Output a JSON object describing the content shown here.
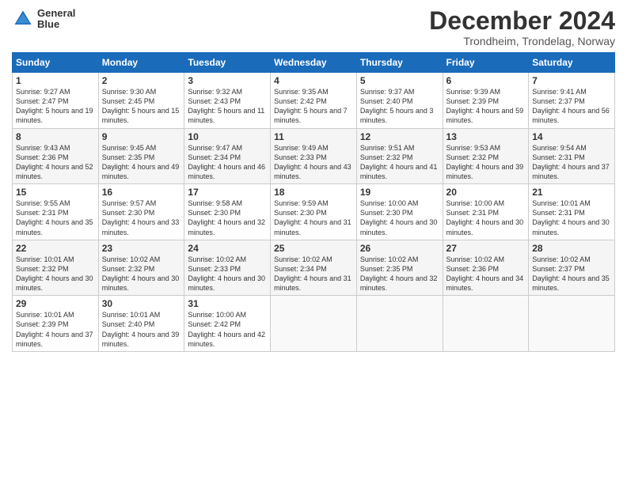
{
  "app": {
    "logo_line1": "General",
    "logo_line2": "Blue"
  },
  "header": {
    "title": "December 2024",
    "subtitle": "Trondheim, Trondelag, Norway"
  },
  "calendar": {
    "days_of_week": [
      "Sunday",
      "Monday",
      "Tuesday",
      "Wednesday",
      "Thursday",
      "Friday",
      "Saturday"
    ],
    "weeks": [
      [
        {
          "day": "1",
          "sunrise": "Sunrise: 9:27 AM",
          "sunset": "Sunset: 2:47 PM",
          "daylight": "Daylight: 5 hours and 19 minutes."
        },
        {
          "day": "2",
          "sunrise": "Sunrise: 9:30 AM",
          "sunset": "Sunset: 2:45 PM",
          "daylight": "Daylight: 5 hours and 15 minutes."
        },
        {
          "day": "3",
          "sunrise": "Sunrise: 9:32 AM",
          "sunset": "Sunset: 2:43 PM",
          "daylight": "Daylight: 5 hours and 11 minutes."
        },
        {
          "day": "4",
          "sunrise": "Sunrise: 9:35 AM",
          "sunset": "Sunset: 2:42 PM",
          "daylight": "Daylight: 5 hours and 7 minutes."
        },
        {
          "day": "5",
          "sunrise": "Sunrise: 9:37 AM",
          "sunset": "Sunset: 2:40 PM",
          "daylight": "Daylight: 5 hours and 3 minutes."
        },
        {
          "day": "6",
          "sunrise": "Sunrise: 9:39 AM",
          "sunset": "Sunset: 2:39 PM",
          "daylight": "Daylight: 4 hours and 59 minutes."
        },
        {
          "day": "7",
          "sunrise": "Sunrise: 9:41 AM",
          "sunset": "Sunset: 2:37 PM",
          "daylight": "Daylight: 4 hours and 56 minutes."
        }
      ],
      [
        {
          "day": "8",
          "sunrise": "Sunrise: 9:43 AM",
          "sunset": "Sunset: 2:36 PM",
          "daylight": "Daylight: 4 hours and 52 minutes."
        },
        {
          "day": "9",
          "sunrise": "Sunrise: 9:45 AM",
          "sunset": "Sunset: 2:35 PM",
          "daylight": "Daylight: 4 hours and 49 minutes."
        },
        {
          "day": "10",
          "sunrise": "Sunrise: 9:47 AM",
          "sunset": "Sunset: 2:34 PM",
          "daylight": "Daylight: 4 hours and 46 minutes."
        },
        {
          "day": "11",
          "sunrise": "Sunrise: 9:49 AM",
          "sunset": "Sunset: 2:33 PM",
          "daylight": "Daylight: 4 hours and 43 minutes."
        },
        {
          "day": "12",
          "sunrise": "Sunrise: 9:51 AM",
          "sunset": "Sunset: 2:32 PM",
          "daylight": "Daylight: 4 hours and 41 minutes."
        },
        {
          "day": "13",
          "sunrise": "Sunrise: 9:53 AM",
          "sunset": "Sunset: 2:32 PM",
          "daylight": "Daylight: 4 hours and 39 minutes."
        },
        {
          "day": "14",
          "sunrise": "Sunrise: 9:54 AM",
          "sunset": "Sunset: 2:31 PM",
          "daylight": "Daylight: 4 hours and 37 minutes."
        }
      ],
      [
        {
          "day": "15",
          "sunrise": "Sunrise: 9:55 AM",
          "sunset": "Sunset: 2:31 PM",
          "daylight": "Daylight: 4 hours and 35 minutes."
        },
        {
          "day": "16",
          "sunrise": "Sunrise: 9:57 AM",
          "sunset": "Sunset: 2:30 PM",
          "daylight": "Daylight: 4 hours and 33 minutes."
        },
        {
          "day": "17",
          "sunrise": "Sunrise: 9:58 AM",
          "sunset": "Sunset: 2:30 PM",
          "daylight": "Daylight: 4 hours and 32 minutes."
        },
        {
          "day": "18",
          "sunrise": "Sunrise: 9:59 AM",
          "sunset": "Sunset: 2:30 PM",
          "daylight": "Daylight: 4 hours and 31 minutes."
        },
        {
          "day": "19",
          "sunrise": "Sunrise: 10:00 AM",
          "sunset": "Sunset: 2:30 PM",
          "daylight": "Daylight: 4 hours and 30 minutes."
        },
        {
          "day": "20",
          "sunrise": "Sunrise: 10:00 AM",
          "sunset": "Sunset: 2:31 PM",
          "daylight": "Daylight: 4 hours and 30 minutes."
        },
        {
          "day": "21",
          "sunrise": "Sunrise: 10:01 AM",
          "sunset": "Sunset: 2:31 PM",
          "daylight": "Daylight: 4 hours and 30 minutes."
        }
      ],
      [
        {
          "day": "22",
          "sunrise": "Sunrise: 10:01 AM",
          "sunset": "Sunset: 2:32 PM",
          "daylight": "Daylight: 4 hours and 30 minutes."
        },
        {
          "day": "23",
          "sunrise": "Sunrise: 10:02 AM",
          "sunset": "Sunset: 2:32 PM",
          "daylight": "Daylight: 4 hours and 30 minutes."
        },
        {
          "day": "24",
          "sunrise": "Sunrise: 10:02 AM",
          "sunset": "Sunset: 2:33 PM",
          "daylight": "Daylight: 4 hours and 30 minutes."
        },
        {
          "day": "25",
          "sunrise": "Sunrise: 10:02 AM",
          "sunset": "Sunset: 2:34 PM",
          "daylight": "Daylight: 4 hours and 31 minutes."
        },
        {
          "day": "26",
          "sunrise": "Sunrise: 10:02 AM",
          "sunset": "Sunset: 2:35 PM",
          "daylight": "Daylight: 4 hours and 32 minutes."
        },
        {
          "day": "27",
          "sunrise": "Sunrise: 10:02 AM",
          "sunset": "Sunset: 2:36 PM",
          "daylight": "Daylight: 4 hours and 34 minutes."
        },
        {
          "day": "28",
          "sunrise": "Sunrise: 10:02 AM",
          "sunset": "Sunset: 2:37 PM",
          "daylight": "Daylight: 4 hours and 35 minutes."
        }
      ],
      [
        {
          "day": "29",
          "sunrise": "Sunrise: 10:01 AM",
          "sunset": "Sunset: 2:39 PM",
          "daylight": "Daylight: 4 hours and 37 minutes."
        },
        {
          "day": "30",
          "sunrise": "Sunrise: 10:01 AM",
          "sunset": "Sunset: 2:40 PM",
          "daylight": "Daylight: 4 hours and 39 minutes."
        },
        {
          "day": "31",
          "sunrise": "Sunrise: 10:00 AM",
          "sunset": "Sunset: 2:42 PM",
          "daylight": "Daylight: 4 hours and 42 minutes."
        },
        null,
        null,
        null,
        null
      ]
    ]
  }
}
